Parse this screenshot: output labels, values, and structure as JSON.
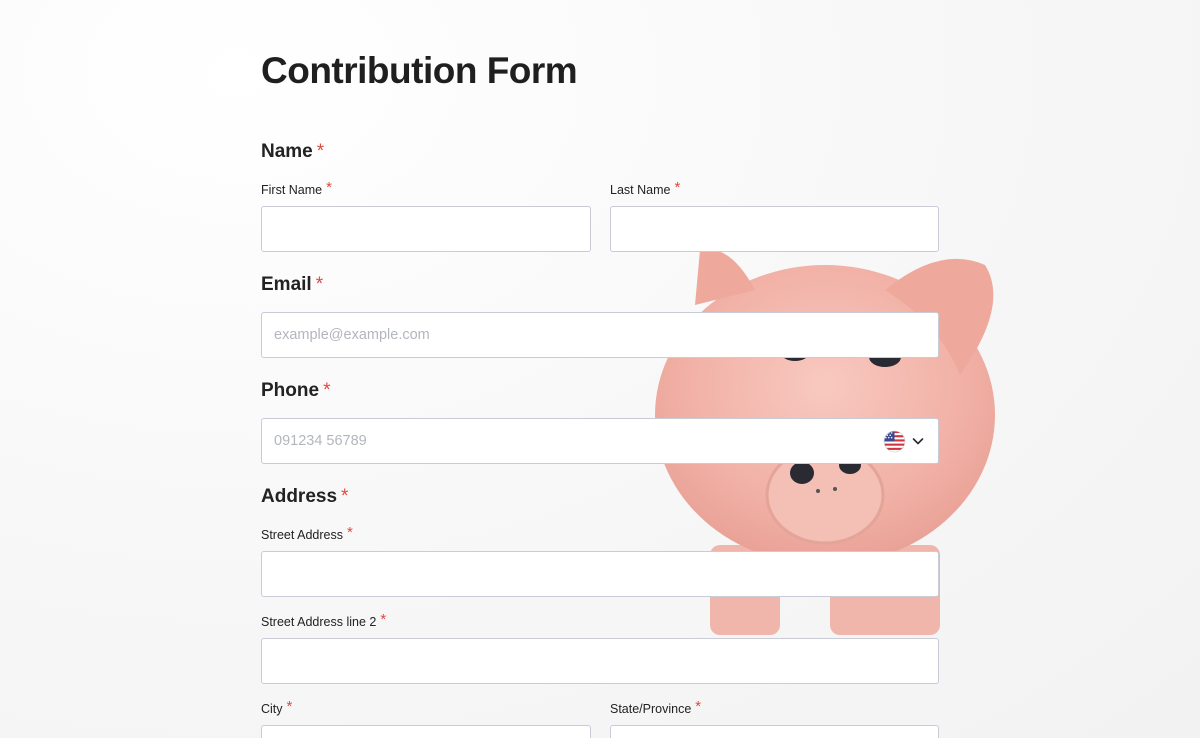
{
  "form": {
    "title": "Contribution Form",
    "required_mark": "*"
  },
  "name": {
    "label": "Name",
    "first_label": "First Name",
    "first_value": "",
    "last_label": "Last Name",
    "last_value": ""
  },
  "email": {
    "label": "Email",
    "placeholder": "example@example.com",
    "value": ""
  },
  "phone": {
    "label": "Phone",
    "placeholder": "091234 56789",
    "value": "",
    "country_icon": "us-flag-icon",
    "dropdown_icon": "chevron-down-icon"
  },
  "address": {
    "label": "Address",
    "street_label": "Street Address",
    "street2_label": "Street Address line 2",
    "city_label": "City",
    "state_label": "State/Province"
  },
  "colors": {
    "required": "#e0493f",
    "border": "#c9ccd6",
    "pig": "#f2b2a8"
  }
}
